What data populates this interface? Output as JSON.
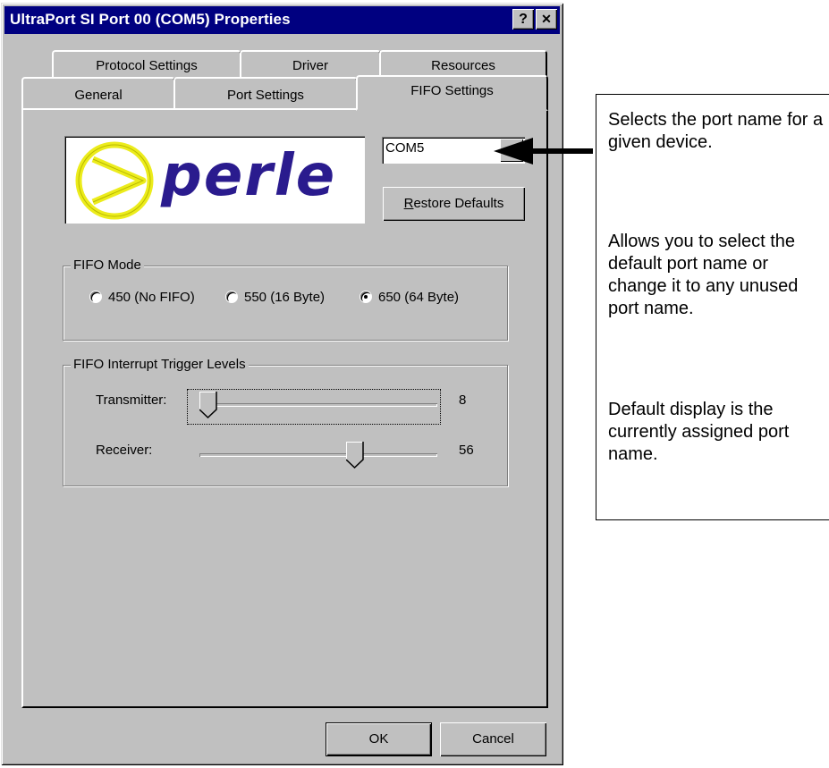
{
  "window": {
    "title": "UltraPort SI Port 00 (COM5) Properties",
    "help_glyph": "?",
    "close_glyph": "✕"
  },
  "tabs": {
    "back": [
      "Protocol Settings",
      "Driver",
      "Resources"
    ],
    "front": [
      "General",
      "Port Settings",
      "FIFO Settings"
    ],
    "active": "FIFO Settings"
  },
  "logo": {
    "text": "perle"
  },
  "port_name": {
    "value": "COM5"
  },
  "restore_button": {
    "label": "Restore Defaults",
    "mnemonic": "R"
  },
  "fifo_mode": {
    "label": "FIFO Mode",
    "options": [
      "450 (No FIFO)",
      "550 (16 Byte)",
      "650 (64 Byte)"
    ],
    "selected": "650 (64 Byte)"
  },
  "trigger_levels": {
    "label": "FIFO Interrupt Trigger Levels",
    "transmitter": {
      "label": "Transmitter:",
      "value": "8",
      "position": 0
    },
    "receiver": {
      "label": "Receiver:",
      "value": "56",
      "position": 0.6
    }
  },
  "footer": {
    "ok_label": "OK",
    "cancel_label": "Cancel"
  },
  "callout": {
    "p1": "Selects the port name for a given device.",
    "p2": "Allows you to select the default port name or change it to any unused port name.",
    "p3": "Default display is the currently assigned port name."
  },
  "colors": {
    "titlebar": "#000080",
    "face": "#c0c0c0",
    "logo_blue": "#2a1b8e",
    "logo_yellow": "#ecec1c"
  }
}
